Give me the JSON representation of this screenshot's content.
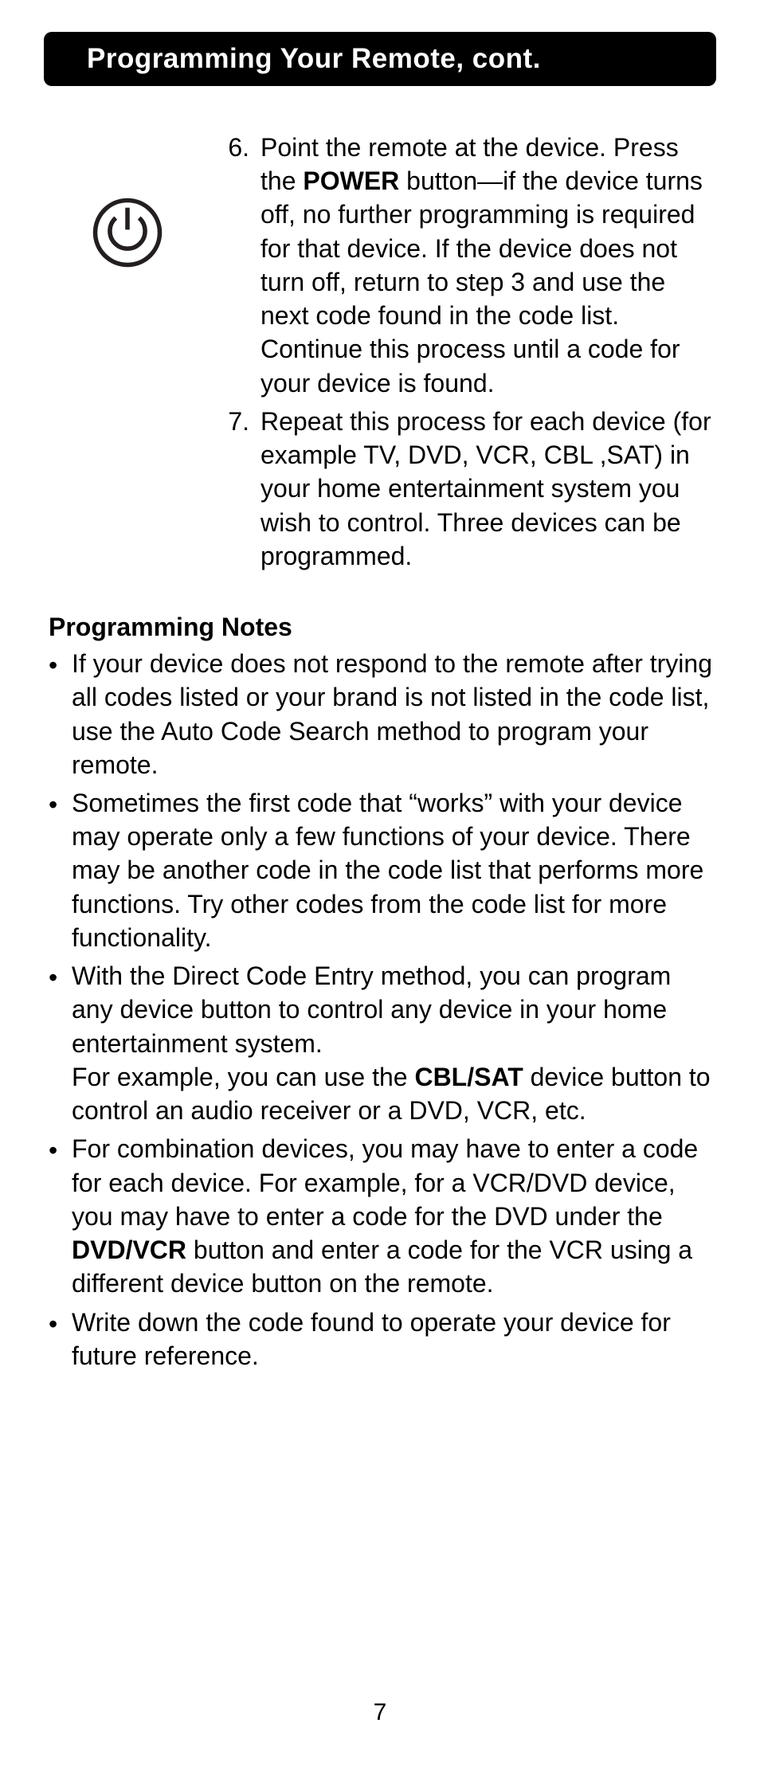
{
  "header": {
    "title": "Programming Your Remote, cont."
  },
  "steps": {
    "item6": {
      "num": "6.",
      "pre": "Point the remote at the device. Press the ",
      "bold": "POWER",
      "post": " button—if the device turns off, no further programming is required for that device. If the device does not turn off, return to step 3 and use the next code found in the code list. Continue this process until a code for your device is found."
    },
    "item7": {
      "num": "7.",
      "text": "Repeat this process for each device (for example TV, DVD, VCR, CBL ,SAT) in your home entertainment system you wish to control. Three devices can be programmed."
    }
  },
  "notes": {
    "heading": "Programming Notes",
    "n1": "If your device does not respond to the remote after trying all codes listed or your brand is not listed in the code list, use the Auto Code Search method to program your remote.",
    "n2": "Sometimes the first code that “works” with your device may operate only a few functions of your device. There may be another code in the code list that performs more functions. Try other codes from the code list for more functionality.",
    "n3": {
      "line1": "With the Direct Code Entry method, you can program any device button to control any device in your home entertainment system.",
      "pre": "For example, you can use the ",
      "bold": "CBL/SAT",
      "post": " device button to control an audio receiver or a DVD, VCR, etc."
    },
    "n4": {
      "pre": "For combination devices, you may have to enter a code for each device. For example, for a VCR/DVD device, you may have to enter a code for the DVD under the ",
      "bold": "DVD/VCR",
      "post": " button and enter a code for the VCR using a different device button on the remote."
    },
    "n5": "Write down the code found to operate your device for future reference."
  },
  "page_number": "7"
}
